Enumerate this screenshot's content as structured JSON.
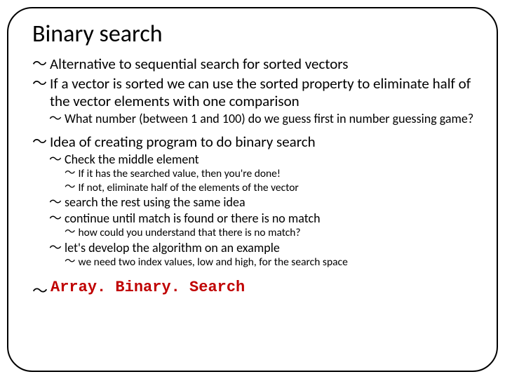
{
  "title": "Binary search",
  "l1a": "Alternative to sequential search for sorted vectors",
  "l1b": "If a vector is sorted we can use the sorted property to eliminate half of the vector elements with one comparison",
  "l2a": "What number (between 1 and 100) do we guess first in number guessing game?",
  "l1c": "Idea of creating program to do binary search",
  "l2b": "Check the middle element",
  "l3a": "If it has the searched value, then you're done!",
  "l3b": "If not, eliminate half of the elements of the vector",
  "l2c": "search the rest using the same idea",
  "l2d": "continue until match is found or there is no match",
  "l3c": "how could you understand that there is no match?",
  "l2e": "let's develop the algorithm on an example",
  "l3d": "we need two index values, low and high, for the search space",
  "final": "Array. Binary. Search"
}
